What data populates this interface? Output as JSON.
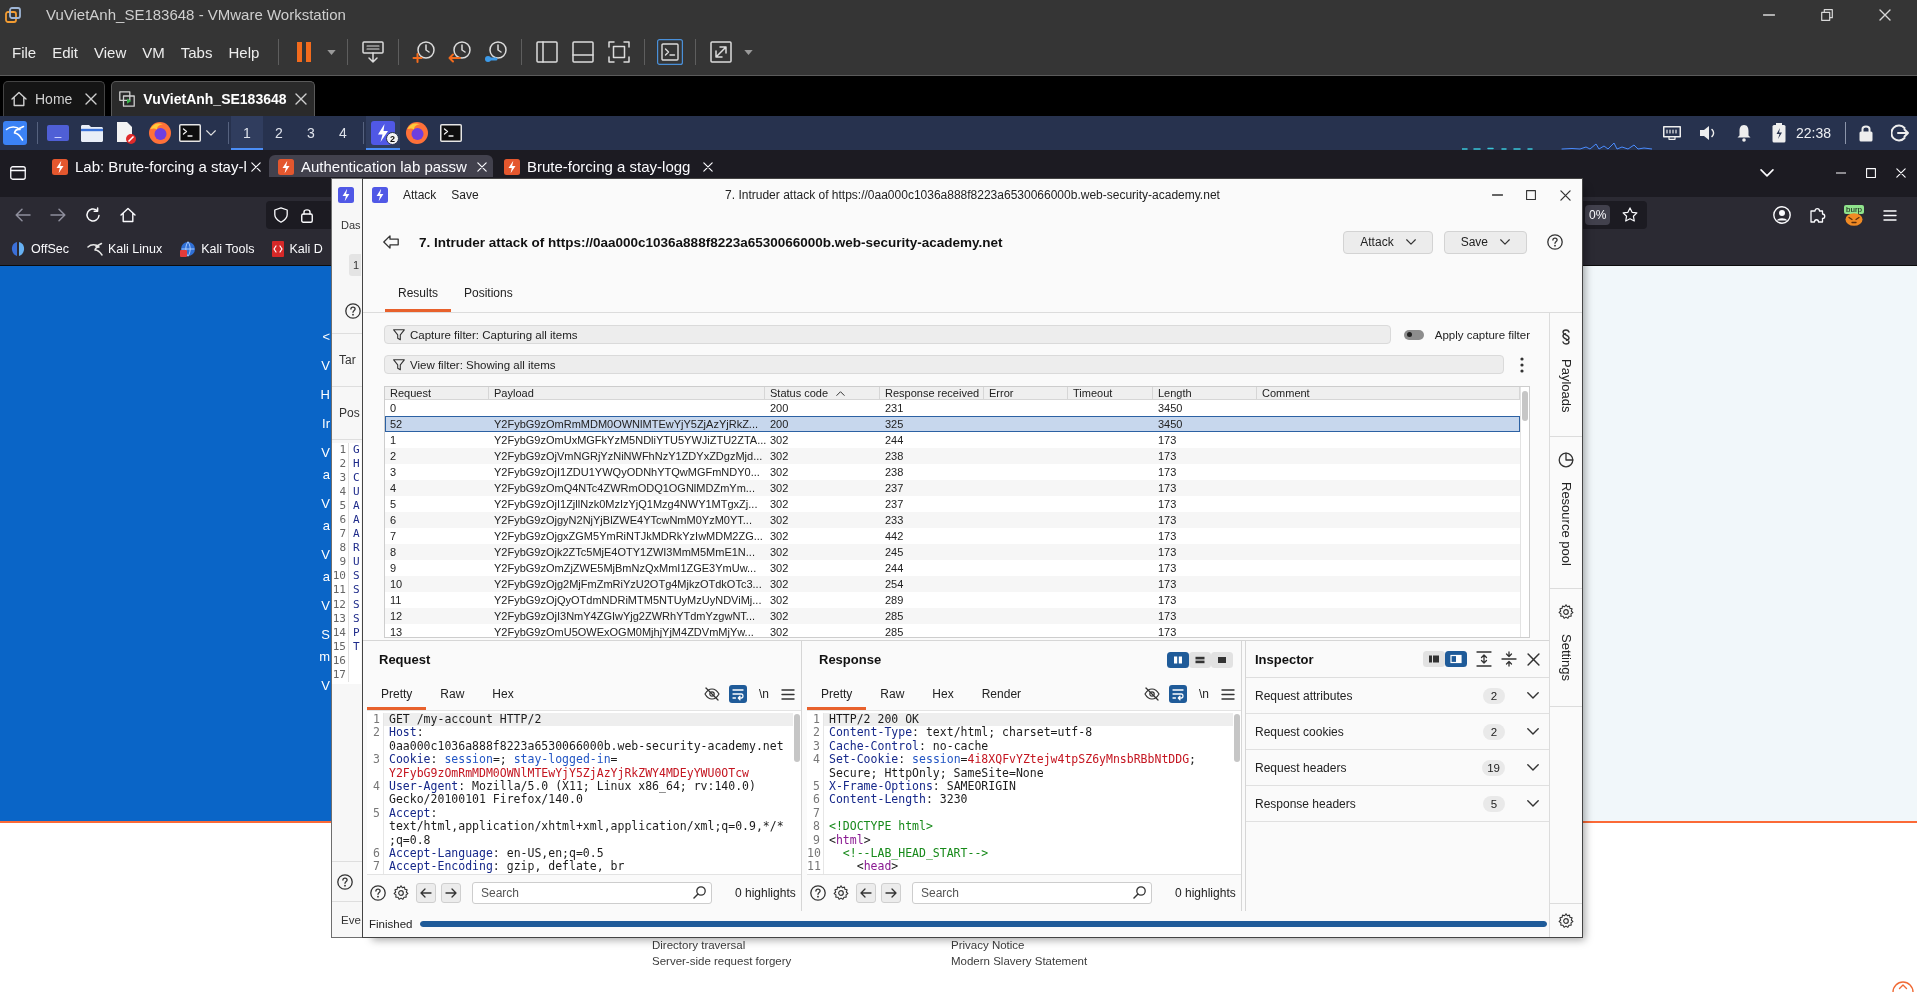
{
  "vmware": {
    "title": "VuVietAnh_SE183648 - VMware Workstation",
    "menu": [
      "File",
      "Edit",
      "View",
      "VM",
      "Tabs",
      "Help"
    ],
    "toolbar_groups": [
      [
        {
          "kind": "pause",
          "dropdown": true,
          "selected": false
        }
      ],
      [
        {
          "kind": "send-keys",
          "dropdown": false,
          "selected": false
        }
      ],
      [
        {
          "kind": "snapshot",
          "dropdown": false,
          "selected": false
        },
        {
          "kind": "revert",
          "dropdown": false,
          "selected": false
        },
        {
          "kind": "snapshot-manager",
          "dropdown": false,
          "selected": false
        }
      ],
      [
        {
          "kind": "sidebar",
          "dropdown": false,
          "selected": false
        },
        {
          "kind": "bottom-panel",
          "dropdown": false,
          "selected": false
        },
        {
          "kind": "fullscreen",
          "dropdown": false,
          "selected": false
        }
      ],
      [
        {
          "kind": "console",
          "dropdown": false,
          "selected": true
        }
      ],
      [
        {
          "kind": "stretch",
          "dropdown": true,
          "selected": false
        }
      ]
    ],
    "tabs": [
      {
        "kind": "home",
        "label": "Home",
        "selected": false
      },
      {
        "kind": "vm",
        "label": "VuVietAnh_SE183648",
        "selected": true
      }
    ]
  },
  "kali_panel": {
    "launchers": [
      {
        "kind": "desktop",
        "dropdown": false
      },
      {
        "kind": "files",
        "dropdown": false
      },
      {
        "kind": "editor",
        "dropdown": false
      },
      {
        "kind": "firefox",
        "dropdown": false
      },
      {
        "kind": "terminal",
        "dropdown": true
      }
    ],
    "workspaces": [
      {
        "label": "1",
        "selected": true
      },
      {
        "label": "2",
        "selected": false
      },
      {
        "label": "3",
        "selected": false
      },
      {
        "label": "4",
        "selected": false
      }
    ],
    "tasks": [
      {
        "kind": "burp",
        "badge": "2",
        "active": true
      },
      {
        "kind": "firefox",
        "active": false
      },
      {
        "kind": "terminal",
        "active": false
      }
    ],
    "clock": "22:38"
  },
  "firefox": {
    "tabs": [
      {
        "label": "Lab: Brute-forcing a stay-l",
        "selected": false
      },
      {
        "label": "Authentication lab passw",
        "selected": true
      },
      {
        "label": "Brute-forcing a stay-logg",
        "selected": false
      }
    ],
    "zoom": "0%",
    "extension_label": "burp",
    "bookmarks": [
      {
        "kind": "offsec",
        "label": "OffSec"
      },
      {
        "kind": "kali",
        "label": "Kali Linux"
      },
      {
        "kind": "tools",
        "label": "Kali Tools"
      },
      {
        "kind": "docs",
        "label": "Kali D"
      }
    ]
  },
  "lab_page": {
    "side_fragments": [
      [
        "<"
      ],
      [
        "V"
      ],
      [
        "H"
      ],
      [
        "Ir"
      ],
      [
        "V",
        "a"
      ],
      [
        "V",
        "a"
      ],
      [
        "V",
        "a"
      ],
      [
        "V"
      ],
      [
        "S",
        "m"
      ],
      [
        "V"
      ]
    ],
    "footer_columns": [
      [
        "Directory traversal",
        "Server-side request forgery"
      ],
      [
        "Privacy Notice",
        "Modern Slavery Statement"
      ]
    ]
  },
  "burp_main": {
    "nav_label": "Das",
    "tab_label": "1",
    "section_labels": [
      "Tar",
      "Pos"
    ],
    "editor_lines": [
      {
        "number": "1",
        "start": "G"
      },
      {
        "number": "2",
        "start": "H"
      },
      {
        "number": "3",
        "start": "C"
      },
      {
        "number": "4",
        "start": "U"
      },
      {
        "number": "5",
        "start": "A"
      },
      {
        "number": "6",
        "start": "A"
      },
      {
        "number": "7",
        "start": "A"
      },
      {
        "number": "8",
        "start": "R"
      },
      {
        "number": "9",
        "start": "U"
      },
      {
        "number": "10",
        "start": "S"
      },
      {
        "number": "11",
        "start": "S"
      },
      {
        "number": "12",
        "start": "S"
      },
      {
        "number": "13",
        "start": "S"
      },
      {
        "number": "14",
        "start": "P"
      },
      {
        "number": "15",
        "start": "T"
      },
      {
        "number": "16"
      },
      {
        "number": "17"
      }
    ],
    "footer_label": "Eve"
  },
  "attack_window": {
    "title": "7. Intruder attack of https://0aa000c1036a888f8223a6530066000b.web-security-academy.net",
    "menu": [
      "Attack",
      "Save"
    ],
    "heading": "7. Intruder attack of https://0aa000c1036a888f8223a6530066000b.web-security-academy.net",
    "header_buttons": [
      "Attack",
      "Save"
    ],
    "tabs": [
      {
        "label": "Results",
        "selected": true
      },
      {
        "label": "Positions",
        "selected": false
      }
    ],
    "capture_filter": "Capture filter: Capturing all items",
    "apply_capture_filter": {
      "label": "Apply capture filter",
      "on": false
    },
    "view_filter": "View filter: Showing all items",
    "table": {
      "columns": [
        {
          "label": "Request",
          "sorted": false
        },
        {
          "label": "Payload",
          "sorted": false
        },
        {
          "label": "Status code",
          "sorted": true,
          "ascending": true
        },
        {
          "label": "Response received",
          "sorted": false
        },
        {
          "label": "Error",
          "sorted": false
        },
        {
          "label": "Timeout",
          "sorted": false
        },
        {
          "label": "Length",
          "sorted": false
        },
        {
          "label": "Comment",
          "sorted": false
        }
      ],
      "rows": [
        {
          "request": "0",
          "status_code": "200",
          "response_received": "231",
          "length": "3450",
          "selected": false
        },
        {
          "request": "52",
          "payload": "Y2FybG9zOmRmMDM0OWNlMTEwYjY5ZjAzYjRkZ...",
          "status_code": "200",
          "response_received": "325",
          "length": "3450",
          "selected": true
        },
        {
          "request": "1",
          "payload": "Y2FybG9zOmUxMGFkYzM5NDliYTU5YWJiZTU2ZTA...",
          "status_code": "302",
          "response_received": "244",
          "length": "173",
          "selected": false
        },
        {
          "request": "2",
          "payload": "Y2FybG9zOjVmNGRjYzNiNWFhNzY1ZDYxZDgzMjd...",
          "status_code": "302",
          "response_received": "238",
          "length": "173",
          "selected": false
        },
        {
          "request": "3",
          "payload": "Y2FybG9zOjI1ZDU1YWQyODNhYTQwMGFmNDY0...",
          "status_code": "302",
          "response_received": "238",
          "length": "173",
          "selected": false
        },
        {
          "request": "4",
          "payload": "Y2FybG9zOmQ4NTc4ZWRmODQ1OGNlMDZmYm...",
          "status_code": "302",
          "response_received": "237",
          "length": "173",
          "selected": false
        },
        {
          "request": "5",
          "payload": "Y2FybG9zOjI1ZjllNzk0MzIzYjQ1Mzg4NWY1MTgxZj...",
          "status_code": "302",
          "response_received": "237",
          "length": "173",
          "selected": false
        },
        {
          "request": "6",
          "payload": "Y2FybG9zOjgyN2NjYjBlZWE4YTcwNmM0YzM0YT...",
          "status_code": "302",
          "response_received": "233",
          "length": "173",
          "selected": false
        },
        {
          "request": "7",
          "payload": "Y2FybG9zOjgxZGM5YmRiNTJkMDRkYzIwMDM2ZG...",
          "status_code": "302",
          "response_received": "442",
          "length": "173",
          "selected": false
        },
        {
          "request": "8",
          "payload": "Y2FybG9zOjk2ZTc5MjE4OTY1ZWI3MmM5MmE1N...",
          "status_code": "302",
          "response_received": "245",
          "length": "173",
          "selected": false
        },
        {
          "request": "9",
          "payload": "Y2FybG9zOmZjZWE5MjBmNzQxMmI1ZGE3YmUw...",
          "status_code": "302",
          "response_received": "244",
          "length": "173",
          "selected": false
        },
        {
          "request": "10",
          "payload": "Y2FybG9zOjg2MjFmZmRiYzU2OTg4MjkzOTdkOTc3...",
          "status_code": "302",
          "response_received": "254",
          "length": "173",
          "selected": false
        },
        {
          "request": "11",
          "payload": "Y2FybG9zOjQyOTdmNDRiMTM5NTUyMzUyNDViMj...",
          "status_code": "302",
          "response_received": "289",
          "length": "173",
          "selected": false
        },
        {
          "request": "12",
          "payload": "Y2FybG9zOjI3NmY4ZGIwYjg2ZWRhYTdmYzgwNT...",
          "status_code": "302",
          "response_received": "285",
          "length": "173",
          "selected": false
        },
        {
          "request": "13",
          "payload": "Y2FybG9zOmU5OWExOGM0MjhjYjM4ZDVmMjYw...",
          "status_code": "302",
          "response_received": "285",
          "length": "173",
          "selected": false
        }
      ]
    },
    "request": {
      "title": "Request",
      "tabs": [
        {
          "label": "Pretty",
          "selected": true
        },
        {
          "label": "Raw",
          "selected": false
        },
        {
          "label": "Hex",
          "selected": false
        }
      ],
      "wrap": true,
      "newline_label": "\\n",
      "lines": [
        {
          "number": "1",
          "current": true,
          "rows": [
            [
              {
                "kind": "plain",
                "text": "GET /my-account HTTP/2"
              }
            ]
          ]
        },
        {
          "number": "2",
          "current": false,
          "rows": [
            [
              {
                "kind": "header",
                "text": "Host"
              },
              {
                "kind": "plain",
                "text": ":"
              }
            ],
            [
              {
                "kind": "plain",
                "text": "0aa000c1036a888f8223a6530066000b.web-security-academy.net"
              }
            ]
          ]
        },
        {
          "number": "3",
          "current": false,
          "rows": [
            [
              {
                "kind": "header",
                "text": "Cookie"
              },
              {
                "kind": "plain",
                "text": ": "
              },
              {
                "kind": "param",
                "text": "session"
              },
              {
                "kind": "plain",
                "text": "=; "
              },
              {
                "kind": "param",
                "text": "stay-logged-in"
              },
              {
                "kind": "plain",
                "text": "="
              }
            ],
            [
              {
                "kind": "value",
                "text": "Y2FybG9zOmRmMDM0OWNlMTEwYjY5ZjAzYjRkZWY4MDEyYWU0OTcw"
              }
            ]
          ]
        },
        {
          "number": "4",
          "current": false,
          "rows": [
            [
              {
                "kind": "header",
                "text": "User-Agent"
              },
              {
                "kind": "plain",
                "text": ": Mozilla/5.0 (X11; Linux x86_64; rv:140.0)"
              }
            ],
            [
              {
                "kind": "plain",
                "text": "Gecko/20100101 Firefox/140.0"
              }
            ]
          ]
        },
        {
          "number": "5",
          "current": false,
          "rows": [
            [
              {
                "kind": "header",
                "text": "Accept"
              },
              {
                "kind": "plain",
                "text": ":"
              }
            ],
            [
              {
                "kind": "plain",
                "text": "text/html,application/xhtml+xml,application/xml;q=0.9,*/*"
              }
            ],
            [
              {
                "kind": "plain",
                "text": ";q=0.8"
              }
            ]
          ]
        },
        {
          "number": "6",
          "current": false,
          "rows": [
            [
              {
                "kind": "header",
                "text": "Accept-Language"
              },
              {
                "kind": "plain",
                "text": ": en-US,en;q=0.5"
              }
            ]
          ]
        },
        {
          "number": "7",
          "current": false,
          "rows": [
            [
              {
                "kind": "header",
                "text": "Accept-Encoding"
              },
              {
                "kind": "plain",
                "text": ": gzip, deflate, br"
              }
            ]
          ]
        }
      ],
      "search_placeholder": "Search",
      "highlights": "0 highlights"
    },
    "response": {
      "title": "Response",
      "layout_options": [
        {
          "kind": "columns",
          "selected": true
        },
        {
          "kind": "rows",
          "selected": false
        },
        {
          "kind": "single",
          "selected": false
        }
      ],
      "tabs": [
        {
          "label": "Pretty",
          "selected": true
        },
        {
          "label": "Raw",
          "selected": false
        },
        {
          "label": "Hex",
          "selected": false
        },
        {
          "label": "Render",
          "selected": false
        }
      ],
      "wrap": true,
      "newline_label": "\\n",
      "lines": [
        {
          "number": "1",
          "current": true,
          "rows": [
            [
              {
                "kind": "plain",
                "text": "HTTP/2 200 OK"
              }
            ]
          ]
        },
        {
          "number": "2",
          "current": false,
          "rows": [
            [
              {
                "kind": "header",
                "text": "Content-Type"
              },
              {
                "kind": "plain",
                "text": ": text/html; charset=utf-8"
              }
            ]
          ]
        },
        {
          "number": "3",
          "current": false,
          "rows": [
            [
              {
                "kind": "header",
                "text": "Cache-Control"
              },
              {
                "kind": "plain",
                "text": ": no-cache"
              }
            ]
          ]
        },
        {
          "number": "4",
          "current": false,
          "rows": [
            [
              {
                "kind": "header",
                "text": "Set-Cookie"
              },
              {
                "kind": "plain",
                "text": ": "
              },
              {
                "kind": "param",
                "text": "session"
              },
              {
                "kind": "plain",
                "text": "="
              },
              {
                "kind": "value",
                "text": "4i8XQFvYZtejw4tpSZ6yMnsbRBbNtDDG"
              },
              {
                "kind": "plain",
                "text": ";"
              }
            ],
            [
              {
                "kind": "plain",
                "text": "Secure; HttpOnly; SameSite=None"
              }
            ]
          ]
        },
        {
          "number": "5",
          "current": false,
          "rows": [
            [
              {
                "kind": "header",
                "text": "X-Frame-Options"
              },
              {
                "kind": "plain",
                "text": ": SAMEORIGIN"
              }
            ]
          ]
        },
        {
          "number": "6",
          "current": false,
          "rows": [
            [
              {
                "kind": "header",
                "text": "Content-Length"
              },
              {
                "kind": "plain",
                "text": ": 3230"
              }
            ]
          ]
        },
        {
          "number": "7",
          "current": false
        },
        {
          "number": "8",
          "current": false,
          "rows": [
            [
              {
                "kind": "comment",
                "text": "<!DOCTYPE html>"
              }
            ]
          ]
        },
        {
          "number": "9",
          "current": false,
          "rows": [
            [
              {
                "kind": "plain",
                "text": "<"
              },
              {
                "kind": "tag",
                "text": "html"
              },
              {
                "kind": "plain",
                "text": ">"
              }
            ]
          ]
        },
        {
          "number": "10",
          "current": false,
          "rows": [
            [
              {
                "kind": "comment",
                "text": "  <!--LAB_HEAD_START-->"
              }
            ]
          ]
        },
        {
          "number": "11",
          "current": false,
          "rows": [
            [
              {
                "kind": "plain",
                "text": "    <"
              },
              {
                "kind": "tag",
                "text": "head"
              },
              {
                "kind": "plain",
                "text": ">"
              }
            ]
          ]
        }
      ],
      "search_placeholder": "Search",
      "highlights": "0 highlights"
    },
    "inspector": {
      "title": "Inspector",
      "view_options": [
        {
          "kind": "left-panel",
          "selected": false
        },
        {
          "kind": "right-panel",
          "selected": true
        }
      ],
      "sections": [
        {
          "label": "Request attributes",
          "count": "2",
          "expanded": false
        },
        {
          "label": "Request cookies",
          "count": "2",
          "expanded": false
        },
        {
          "label": "Request headers",
          "count": "19",
          "expanded": false
        },
        {
          "label": "Response headers",
          "count": "5",
          "expanded": false
        }
      ]
    },
    "sidebar": [
      {
        "kind": "payloads",
        "label": "Payloads"
      },
      {
        "kind": "resource-pool",
        "label": "Resource pool"
      },
      {
        "kind": "settings",
        "label": "Settings"
      }
    ],
    "status": {
      "label": "Finished",
      "level": 1
    }
  }
}
